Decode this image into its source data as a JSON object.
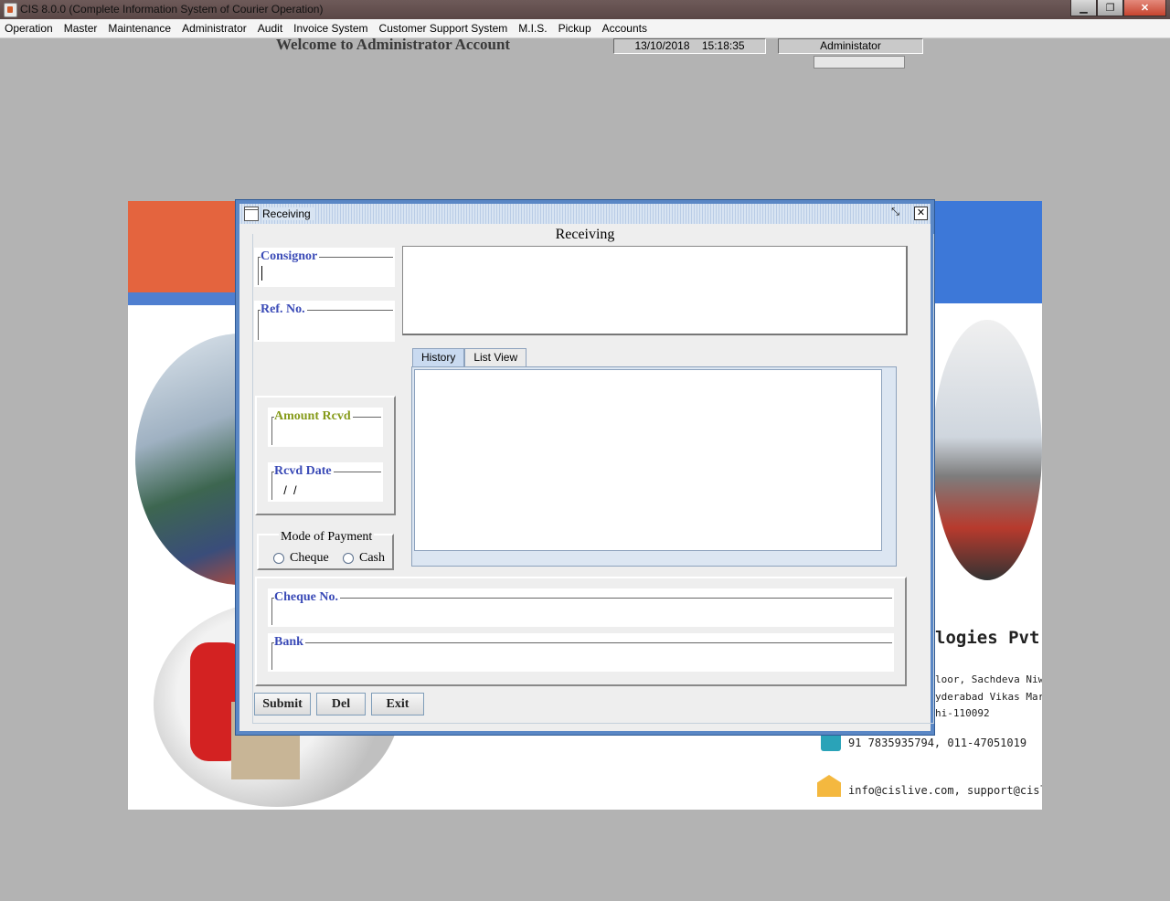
{
  "window": {
    "title": "CIS 8.0.0 (Complete Information System of Courier Operation)",
    "controls": {
      "minimize": "▁",
      "restore": "❐",
      "close": "✕"
    }
  },
  "menu": [
    "Operation",
    "Master",
    "Maintenance",
    "Administrator",
    "Audit",
    "Invoice System",
    "Customer Support System",
    "M.I.S.",
    "Pickup",
    "Accounts"
  ],
  "header": {
    "welcome": "Welcome to Administrator Account",
    "date": "13/10/2018",
    "time": "15:18:35",
    "user": "Administator"
  },
  "banner": {
    "company": "logies Pvt Ltd",
    "address_lines": [
      "loor, Sachdeva Niwas",
      "yderabad Vikas Marg,",
      "hi-110092"
    ],
    "phone": "91 7835935794, 011-47051019",
    "email": "info@cislive.com, support@cislive.com"
  },
  "frame": {
    "title": "Receiving",
    "heading": "Receiving",
    "fields": {
      "consignor": {
        "label": "Consignor",
        "value": ""
      },
      "ref_no": {
        "label": "Ref. No.",
        "value": ""
      },
      "amount_rcvd": {
        "label": "Amount Rcvd",
        "value": ""
      },
      "rcvd_date": {
        "label": "Rcvd Date",
        "value": "  /  /"
      },
      "cheque_no": {
        "label": "Cheque No.",
        "value": ""
      },
      "bank": {
        "label": "Bank",
        "value": ""
      }
    },
    "mode_of_payment": {
      "label": "Mode of Payment",
      "options": [
        "Cheque",
        "Cash"
      ],
      "selected": ""
    },
    "tabs": [
      {
        "label": "History",
        "active": true
      },
      {
        "label": "List View",
        "active": false
      }
    ],
    "buttons": {
      "submit": "Submit",
      "del": "Del",
      "exit": "Exit"
    }
  }
}
